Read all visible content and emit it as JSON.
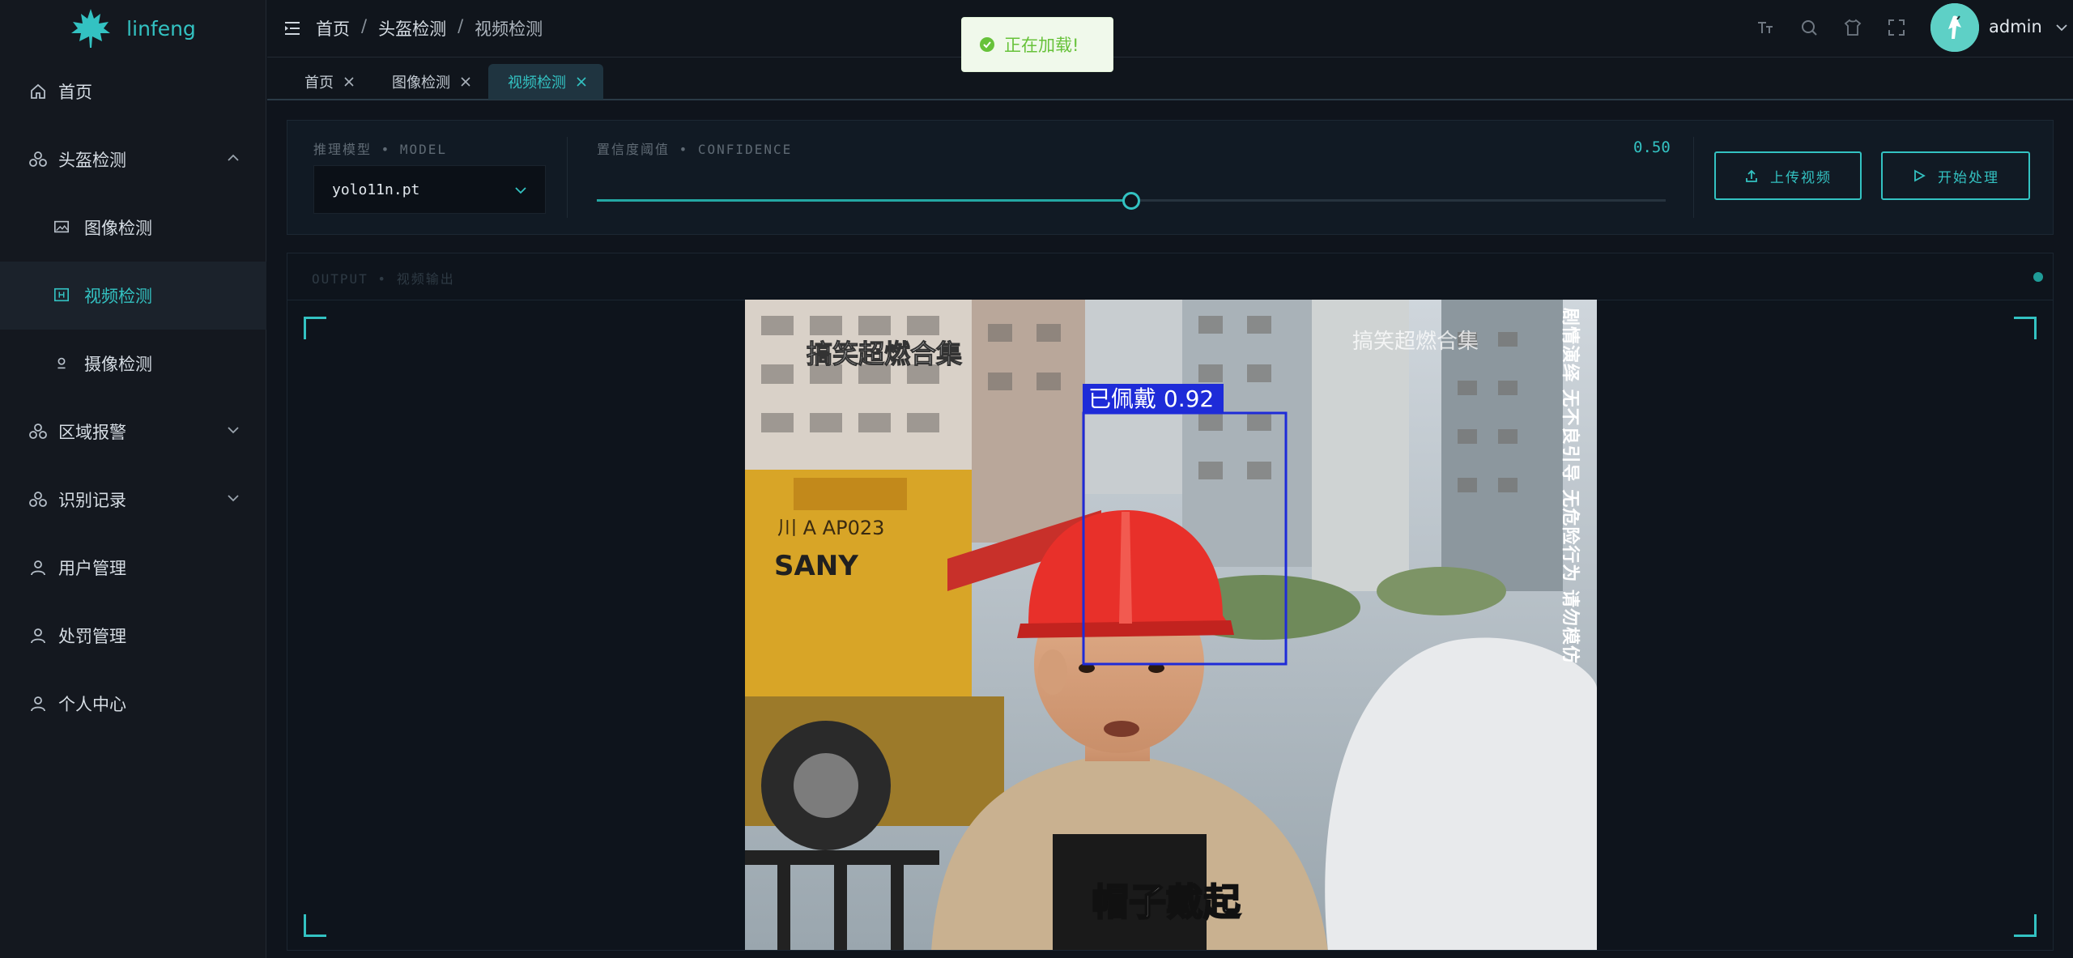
{
  "brand": {
    "name": "linfeng",
    "accent": "#33c2c2"
  },
  "sidebar": {
    "items": [
      {
        "label": "首页",
        "icon": "home-icon"
      },
      {
        "label": "头盔检测",
        "icon": "helmet-icon",
        "expanded": true
      },
      {
        "label": "图像检测",
        "icon": "image-icon"
      },
      {
        "label": "视频检测",
        "icon": "video-icon",
        "active": true
      },
      {
        "label": "摄像检测",
        "icon": "camera-icon"
      },
      {
        "label": "区域报警",
        "icon": "alarm-icon"
      },
      {
        "label": "识别记录",
        "icon": "record-icon"
      },
      {
        "label": "用户管理",
        "icon": "user-icon"
      },
      {
        "label": "处罚管理",
        "icon": "user-icon"
      },
      {
        "label": "个人中心",
        "icon": "user-icon"
      }
    ]
  },
  "header": {
    "breadcrumb": [
      "首页",
      "头盔检测",
      "视频检测"
    ],
    "separator": "/",
    "username": "admin"
  },
  "toast": {
    "text": "正在加载!",
    "type": "success"
  },
  "tabs": [
    {
      "label": "首页"
    },
    {
      "label": "图像检测"
    },
    {
      "label": "视频检测",
      "active": true
    }
  ],
  "controls": {
    "model_label": "推理模型 • MODEL",
    "model_value": "yolo11n.pt",
    "confidence_label": "置信度阈值 • CONFIDENCE",
    "confidence_value": "0.50",
    "confidence": 0.5,
    "upload_label": "上传视频",
    "start_label": "开始处理"
  },
  "output": {
    "label": "OUTPUT • 视频输出",
    "video": {
      "watermark_left": "搞笑超燃合集",
      "watermark_right": "搞笑超燃合集",
      "vertical_disclaimer": "剧情演绎 无不良引导 无危险行为 请勿模仿",
      "caption": "帽子戴起",
      "crane_brand": "SANY",
      "crane_plate": "川 A AP023",
      "detection_label": "已佩戴 0.92",
      "detection_confidence": 0.92
    }
  }
}
